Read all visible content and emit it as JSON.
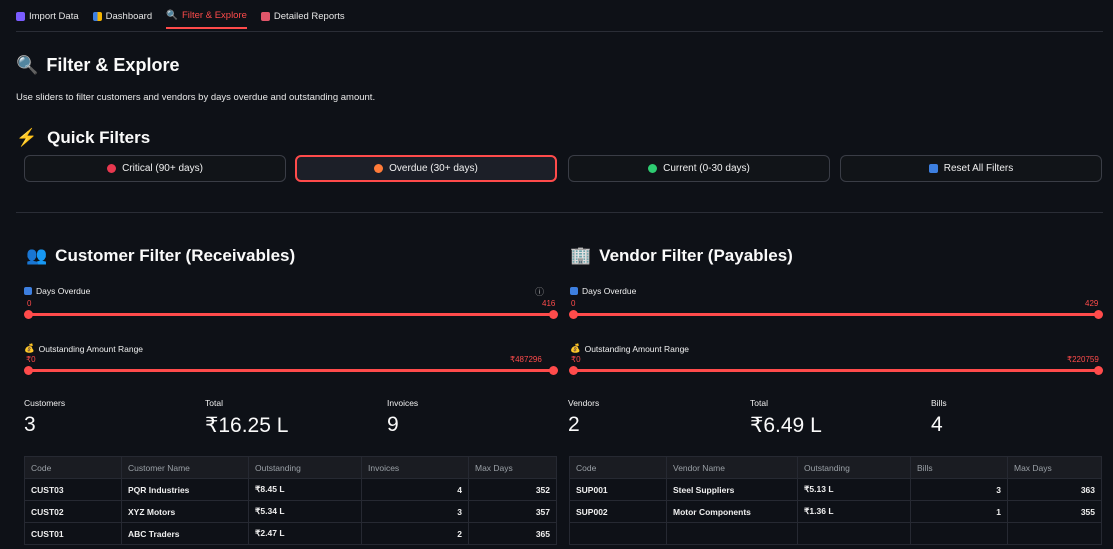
{
  "tabs": [
    {
      "label": "Import Data",
      "icon": "inbox-icon"
    },
    {
      "label": "Dashboard",
      "icon": "chart-icon"
    },
    {
      "label": "Filter & Explore",
      "icon": "magnifier-icon"
    },
    {
      "label": "Detailed Reports",
      "icon": "report-icon"
    }
  ],
  "page": {
    "title": "Filter & Explore",
    "description": "Use sliders to filter customers and vendors by days overdue and outstanding amount."
  },
  "quick_filters": {
    "title": "Quick Filters",
    "buttons": [
      {
        "label": "Critical (90+ days)",
        "color": "#e8384f"
      },
      {
        "label": "Overdue (30+ days)",
        "color": "#ff7b39"
      },
      {
        "label": "Current (0-30 days)",
        "color": "#2ecc71"
      },
      {
        "label": "Reset All Filters",
        "color": "#3d7fe0"
      }
    ]
  },
  "customer": {
    "title": "Customer Filter (Receivables)",
    "days_label": "Days Overdue",
    "days_min": "0",
    "days_max": "416",
    "amount_label": "Outstanding Amount Range",
    "amount_min": "₹0",
    "amount_max": "₹487296",
    "metrics": [
      {
        "label": "Customers",
        "value": "3"
      },
      {
        "label": "Total",
        "value": "₹16.25 L"
      },
      {
        "label": "Invoices",
        "value": "9"
      }
    ],
    "columns": [
      "Code",
      "Customer Name",
      "Outstanding",
      "Invoices",
      "Max Days"
    ],
    "rows": [
      [
        "CUST03",
        "PQR Industries",
        "₹8.45 L",
        "4",
        "352"
      ],
      [
        "CUST02",
        "XYZ Motors",
        "₹5.34 L",
        "3",
        "357"
      ],
      [
        "CUST01",
        "ABC Traders",
        "₹2.47 L",
        "2",
        "365"
      ]
    ]
  },
  "vendor": {
    "title": "Vendor Filter (Payables)",
    "days_label": "Days Overdue",
    "days_min": "0",
    "days_max": "429",
    "amount_label": "Outstanding Amount Range",
    "amount_min": "₹0",
    "amount_max": "₹220759",
    "metrics": [
      {
        "label": "Vendors",
        "value": "2"
      },
      {
        "label": "Total",
        "value": "₹6.49 L"
      },
      {
        "label": "Bills",
        "value": "4"
      }
    ],
    "columns": [
      "Code",
      "Vendor Name",
      "Outstanding",
      "Bills",
      "Max Days"
    ],
    "rows": [
      [
        "SUP001",
        "Steel Suppliers",
        "₹5.13 L",
        "3",
        "363"
      ],
      [
        "SUP002",
        "Motor Components",
        "₹1.36 L",
        "1",
        "355"
      ],
      [
        "",
        "",
        "",
        "",
        ""
      ]
    ]
  },
  "colors": {
    "accent": "#ff4b4b",
    "background": "#0e1117"
  }
}
